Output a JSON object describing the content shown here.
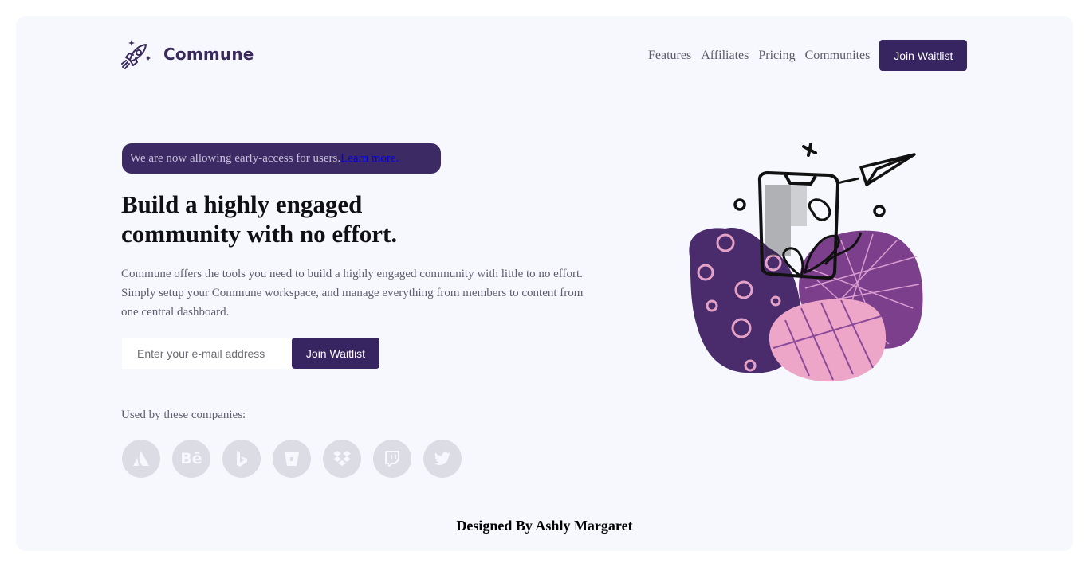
{
  "brand": {
    "name": "Commune",
    "icon": "rocket-icon"
  },
  "nav": {
    "links": [
      "Features",
      "Affiliates",
      "Pricing",
      "Communites"
    ],
    "cta": "Join Waitlist"
  },
  "announcement": {
    "text": "We are now allowing early-access for users.",
    "link": "Learn more."
  },
  "hero": {
    "headline": "Build a highly engaged community with no effort.",
    "description": "Commune offers the tools you need to build a highly engaged community with little to no effort. Simply setup your Commune workspace, and manage everything from members to content from one central dashboard.",
    "email_placeholder": "Enter your e-mail address",
    "cta": "Join Waitlist"
  },
  "companies": {
    "label": "Used by these companies:",
    "logos": [
      "atlassian-icon",
      "behance-icon",
      "bing-icon",
      "bitbucket-icon",
      "dropbox-icon",
      "twitch-icon",
      "twitter-icon"
    ],
    "behance_text": "Bē"
  },
  "footer": {
    "credit": "Designed By Ashly Margaret"
  },
  "colors": {
    "primary": "#372561",
    "background": "#f6f8fd",
    "logo_gray": "#dcdde4",
    "illustration_purple": "#4a2c6d",
    "illustration_pink": "#eea6c8"
  }
}
